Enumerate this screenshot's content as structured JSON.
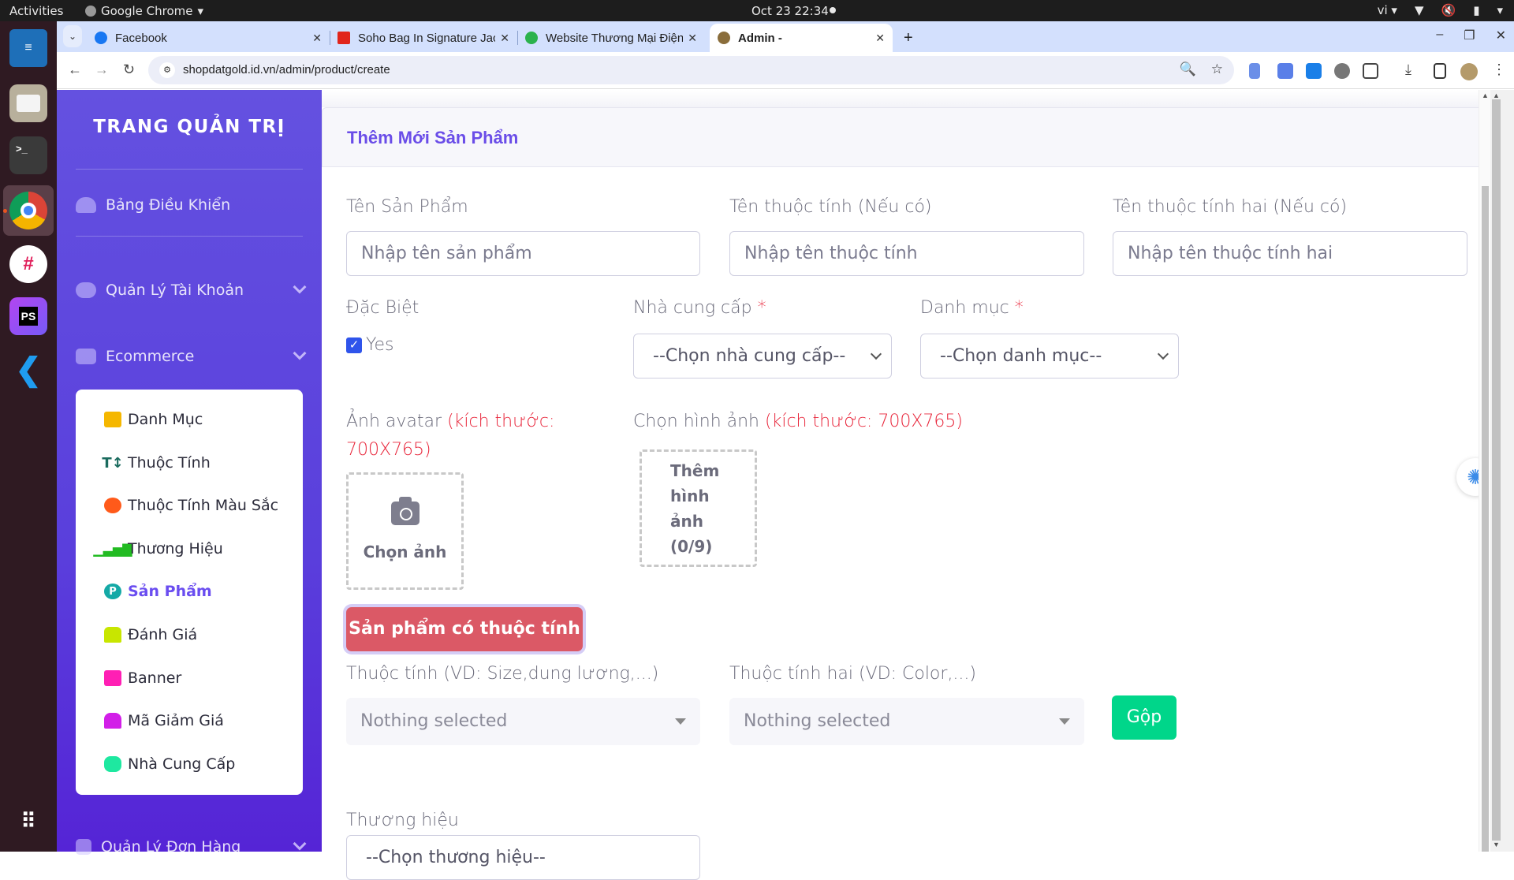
{
  "os": {
    "activities": "Activities",
    "app_name": "Google Chrome",
    "clock": "Oct 23  22:34",
    "lang": "vi",
    "dock": [
      "libreoffice-writer",
      "files",
      "terminal",
      "chrome",
      "slack",
      "phpstorm",
      "vscode",
      "app-grid"
    ]
  },
  "browser": {
    "tabs": [
      {
        "title": "Facebook",
        "favicon": "facebook-icon",
        "color": "#1877f2",
        "active": false
      },
      {
        "title": "Soho Bag In Signature Jacquard",
        "favicon": "adobe-icon",
        "color": "#e1251b",
        "active": false
      },
      {
        "title": "Website Thương Mại Điện Tử",
        "favicon": "leaf-icon",
        "color": "#2bb24c",
        "active": false
      },
      {
        "title": "Admin -",
        "favicon": "site-icon",
        "color": "#8a6d3b",
        "active": true
      }
    ],
    "url": "shopdatgold.id.vn/admin/product/create"
  },
  "sidebar": {
    "title": "TRANG QUẢN TRỊ",
    "items": [
      {
        "label": "Bảng Điều Khiển",
        "icon": "dashboard-icon"
      },
      {
        "label": "Quản Lý Tài Khoản",
        "icon": "user-shield-icon",
        "expandable": true
      },
      {
        "label": "Ecommerce",
        "icon": "store-icon",
        "expandable": true,
        "expanded": true
      },
      {
        "label": "Quản Lý Đơn Hàng",
        "icon": "shopify-icon",
        "expandable": true
      }
    ],
    "submenu": [
      {
        "label": "Danh Mục",
        "icon": "category-icon",
        "color": "#f5b700"
      },
      {
        "label": "Thuộc Tính",
        "icon": "text-height-icon",
        "color": "#1a6b5e"
      },
      {
        "label": "Thuộc Tính Màu Sắc",
        "icon": "palette-icon",
        "color": "#ff5a1a"
      },
      {
        "label": "Thương Hiệu",
        "icon": "signal-icon",
        "color": "#22bb22"
      },
      {
        "label": "Sản Phẩm",
        "icon": "product-p-icon",
        "color": "#14a9a6",
        "active": true
      },
      {
        "label": "Đánh Giá",
        "icon": "thumbs-up-icon",
        "color": "#c8e600"
      },
      {
        "label": "Banner",
        "icon": "banner-icon",
        "color": "#ff1fb4"
      },
      {
        "label": "Mã Giảm Giá",
        "icon": "bag-icon",
        "color": "#d21fe8"
      },
      {
        "label": "Nhà Cung Cấp",
        "icon": "handshake-icon",
        "color": "#1ee8a0"
      }
    ]
  },
  "form": {
    "title": "Thêm Mới Sản Phẩm",
    "product_name": {
      "label": "Tên Sản Phẩm",
      "placeholder": "Nhập tên sản phẩm",
      "value": ""
    },
    "attr_name": {
      "label": "Tên thuộc tính (Nếu có)",
      "placeholder": "Nhập tên thuộc tính",
      "value": ""
    },
    "attr2_name": {
      "label": "Tên thuộc tính hai (Nếu có)",
      "placeholder": "Nhập tên thuộc tính hai",
      "value": ""
    },
    "special": {
      "label": "Đặc Biệt",
      "option": "Yes",
      "checked": true
    },
    "supplier": {
      "label": "Nhà cung cấp",
      "required_mark": "*",
      "selected": "--Chọn nhà cung cấp--"
    },
    "category": {
      "label": "Danh mục",
      "required_mark": "*",
      "selected": "--Chọn danh mục--"
    },
    "avatar": {
      "label": "Ảnh avatar",
      "size_note": "(kích thước: 700X765)",
      "button": "Chọn ảnh"
    },
    "images": {
      "label": "Chọn hình ảnh",
      "size_note": "(kích thước: 700X765)",
      "button": "Thêm hình ảnh (0/9)",
      "count": 0,
      "max": 9
    },
    "has_attr_button": "Sản phẩm có thuộc tính",
    "attr_select": {
      "label": "Thuộc tính (VD: Size,dung lương,...)",
      "selected": "Nothing selected"
    },
    "attr2_select": {
      "label": "Thuộc tính hai (VD: Color,...)",
      "selected": "Nothing selected"
    },
    "merge_button": "Gộp",
    "brand": {
      "label": "Thương hiệu",
      "selected": "--Chọn thương hiệu--"
    }
  }
}
